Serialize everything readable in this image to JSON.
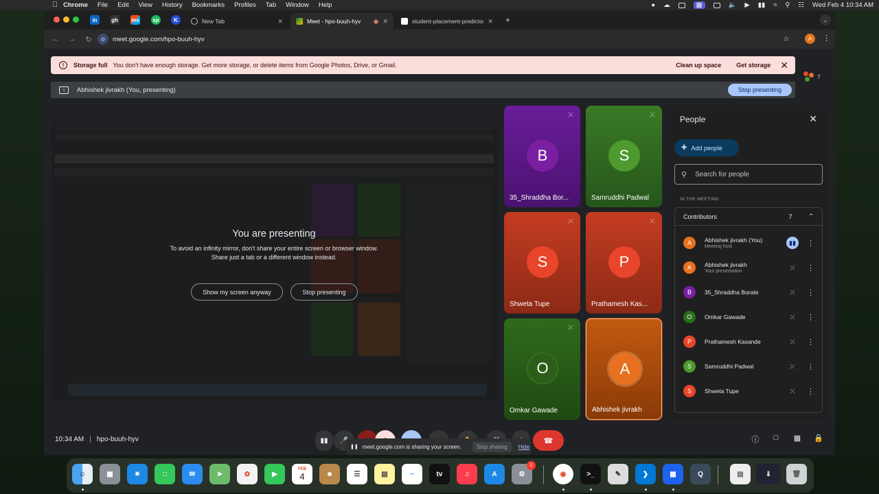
{
  "menubar": {
    "app_name": "Chrome",
    "menus": [
      "File",
      "Edit",
      "View",
      "History",
      "Bookmarks",
      "Profiles",
      "Tab",
      "Window",
      "Help"
    ],
    "datetime": "Wed Feb 4  10:34 AM"
  },
  "browser": {
    "pinned_tabs": [
      "in",
      "gh",
      "ms",
      "sp",
      "K"
    ],
    "tabs": [
      {
        "label": "New Tab"
      },
      {
        "label": "Meet - hpo-buuh-hyv"
      },
      {
        "label": "student-placement-predictor"
      }
    ],
    "url": "meet.google.com/hpo-buuh-hyv",
    "profile_initial": "A"
  },
  "banner": {
    "title": "Storage full",
    "message": "You don't have enough storage. Get more storage, or delete items from Google Photos, Drive, or Gmail.",
    "clean_up": "Clean up space",
    "get_storage": "Get storage"
  },
  "participant_count": "7",
  "presenting_bar": {
    "label": "Abhishek jivrakh (You, presenting)",
    "stop_button": "Stop presenting"
  },
  "presentation": {
    "heading": "You are presenting",
    "line1": "To avoid an infinity mirror, don't share your entire screen or browser window.",
    "line2": "Share just a tab or a different window instead.",
    "show_anyway": "Show my screen anyway",
    "stop": "Stop presenting"
  },
  "tiles": [
    {
      "initial": "B",
      "name": "35_Shraddha Bor...",
      "color": "#7b1fa2",
      "bg": "#5b1f8a",
      "muted": true
    },
    {
      "initial": "S",
      "name": "Samruddhi Padwal",
      "color": "#4e9a2e",
      "bg": "#2f6a1c",
      "muted": true
    },
    {
      "initial": "S",
      "name": "Shweta Tupe",
      "color": "#e8452a",
      "bg": "#b8341c",
      "muted": true
    },
    {
      "initial": "P",
      "name": "Prathamesh Kas...",
      "color": "#e8452a",
      "bg": "#b8341c",
      "muted": true
    },
    {
      "initial": "O",
      "name": "Omkar Gawade",
      "color": "#2c6e1c",
      "bg": "#2f6a1c",
      "muted": true
    },
    {
      "initial": "A",
      "name": "Abhishek jivrakh",
      "color": "#e8711f",
      "bg": "#c25a10",
      "muted": false
    }
  ],
  "people_panel": {
    "title": "People",
    "add_people": "Add people",
    "search_placeholder": "Search for people",
    "section_label": "IN THE MEETING",
    "group_label": "Contributors",
    "group_count": "7",
    "members": [
      {
        "initial": "A",
        "name": "Abhishek jivrakh (You)",
        "sub": "Meeting host",
        "color": "#e8711f"
      },
      {
        "initial": "A",
        "name": "Abhishek jivrakh",
        "sub": "Your presentation",
        "color": "#e8711f"
      },
      {
        "initial": "B",
        "name": "35_Shraddha Borate",
        "sub": "",
        "color": "#7b1fa2"
      },
      {
        "initial": "O",
        "name": "Omkar Gawade",
        "sub": "",
        "color": "#2c6e1c"
      },
      {
        "initial": "P",
        "name": "Prathamesh Kasande",
        "sub": "",
        "color": "#e8452a"
      },
      {
        "initial": "S",
        "name": "Samruddhi Padwal",
        "sub": "",
        "color": "#4e9a2e"
      },
      {
        "initial": "S",
        "name": "Shweta Tupe",
        "sub": "",
        "color": "#e8452a"
      }
    ]
  },
  "bottom": {
    "time": "10:34 AM",
    "meeting_code": "hpo-buuh-hyv",
    "share_notice": "meet.google.com is sharing your screen.",
    "stop_sharing": "Stop sharing",
    "hide": "Hide"
  },
  "dock": {
    "calendar_month": "FEB",
    "calendar_day": "4",
    "appstore_badge": "1"
  }
}
